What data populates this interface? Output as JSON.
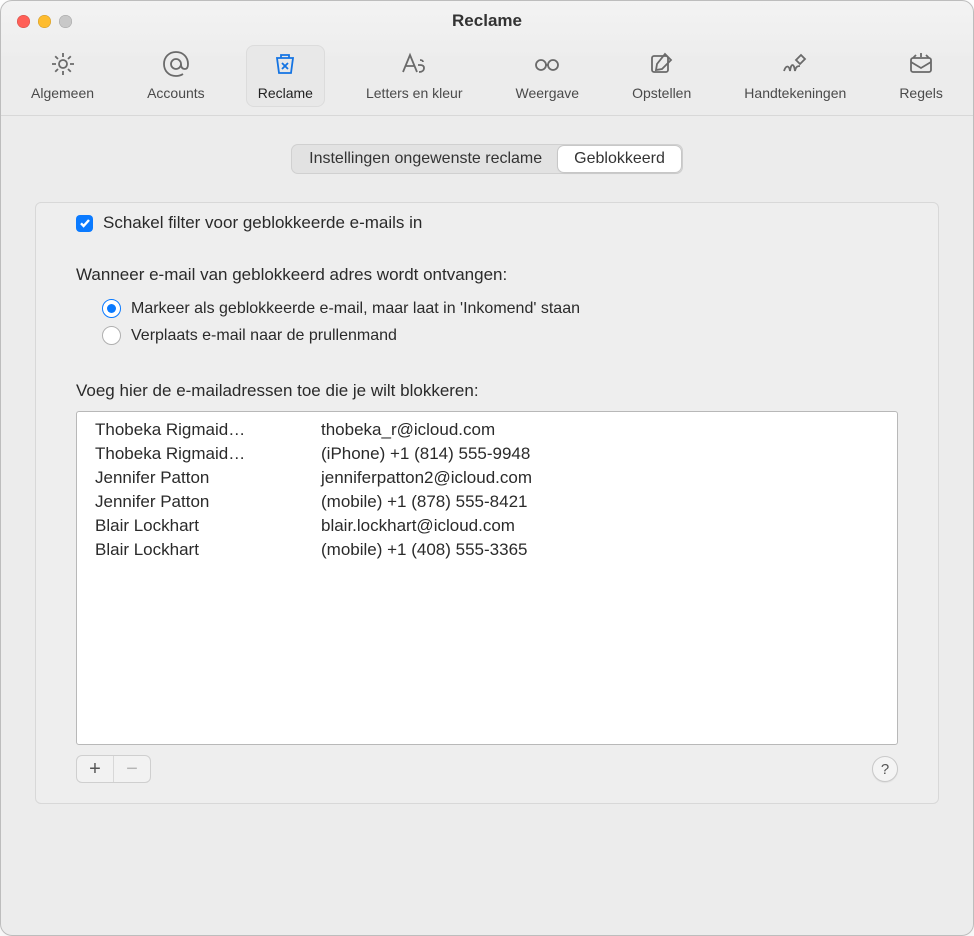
{
  "window": {
    "title": "Reclame"
  },
  "toolbar": {
    "items": [
      {
        "label": "Algemeen",
        "icon": "gear"
      },
      {
        "label": "Accounts",
        "icon": "at"
      },
      {
        "label": "Reclame",
        "icon": "junk",
        "selected": true
      },
      {
        "label": "Letters en kleur",
        "icon": "fonts"
      },
      {
        "label": "Weergave",
        "icon": "glasses"
      },
      {
        "label": "Opstellen",
        "icon": "compose"
      },
      {
        "label": "Handtekeningen",
        "icon": "signature"
      },
      {
        "label": "Regels",
        "icon": "rules"
      }
    ]
  },
  "tabs": {
    "items": [
      {
        "label": "Instellingen ongewenste reclame",
        "selected": false
      },
      {
        "label": "Geblokkeerd",
        "selected": true
      }
    ]
  },
  "enable_filter": {
    "checked": true,
    "label": "Schakel filter voor geblokkeerde e-mails in"
  },
  "when_blocked": {
    "label": "Wanneer e-mail van geblokkeerd adres wordt ontvangen:",
    "options": [
      {
        "label": "Markeer als geblokkeerde e-mail, maar laat in 'Inkomend' staan",
        "selected": true
      },
      {
        "label": "Verplaats e-mail naar de prullenmand",
        "selected": false
      }
    ]
  },
  "blocked_list": {
    "label": "Voeg hier de e-mailadressen toe die je wilt blokkeren:",
    "rows": [
      {
        "name": "Thobeka Rigmaid…",
        "contact": "thobeka_r@icloud.com"
      },
      {
        "name": "Thobeka Rigmaid…",
        "contact": "(iPhone) +1 (814) 555-9948"
      },
      {
        "name": "Jennifer Patton",
        "contact": "jenniferpatton2@icloud.com"
      },
      {
        "name": "Jennifer Patton",
        "contact": "(mobile) +1 (878) 555-8421"
      },
      {
        "name": "Blair Lockhart",
        "contact": "blair.lockhart@icloud.com"
      },
      {
        "name": "Blair Lockhart",
        "contact": "(mobile) +1 (408) 555-3365"
      }
    ]
  },
  "footer": {
    "add": "+",
    "remove": "−",
    "help": "?"
  }
}
